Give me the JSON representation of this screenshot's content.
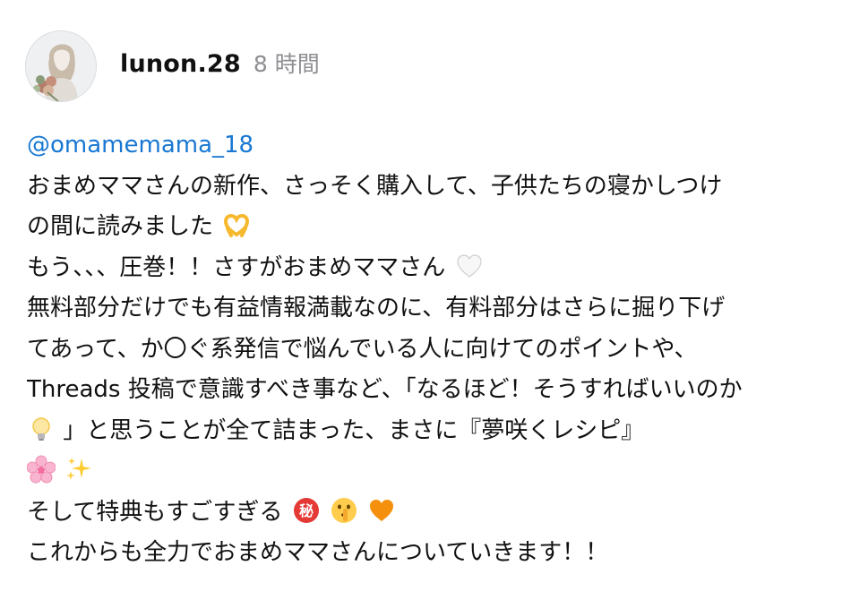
{
  "post": {
    "author": {
      "username": "lunon.28",
      "time": "8 時間"
    },
    "mention": "@omamemama_18",
    "lines": [
      "おまめママさんの新作、さっそく購入して、子供たちの寝かしつけ",
      "の間に読みました",
      "もう、、、圧巻！！さすがおまめママさん",
      "無料部分だけでも有益情報満載なのに、有料部分はさらに掘り下げ",
      "てあって、か〇ぐ系発信で悩んでいる人に向けてのポイントや、",
      "Threads 投稿で意識すべき事など、「なるほど！そうすればいいのか",
      "」と思うことが全て詰まった、まさに『夢咲くレシピ』",
      "",
      "そして特典もすごすぎる",
      "これからも全力でおまめママさんについていきます！！"
    ],
    "emojis": {
      "line2": [
        "heart-hands-icon"
      ],
      "line3": [
        "white-heart-icon"
      ],
      "line7_prefix": [
        "light-bulb-icon"
      ],
      "line8": [
        "cherry-blossom-icon",
        "sparkles-icon"
      ],
      "line9": [
        "secret-ideograph-icon",
        "shushing-face-icon",
        "orange-heart-icon"
      ]
    },
    "colors": {
      "mention": "#1877d2",
      "time": "#8e8e93",
      "text": "#111111"
    }
  }
}
